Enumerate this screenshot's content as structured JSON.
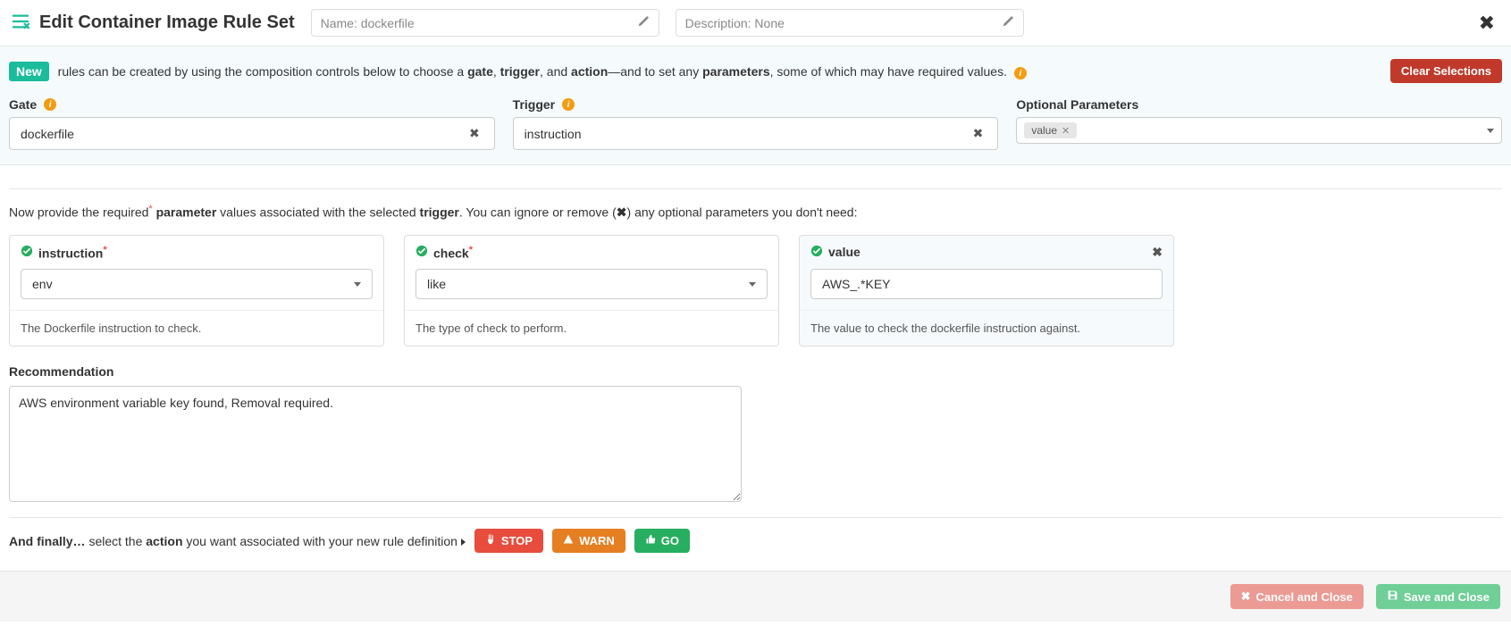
{
  "header": {
    "title": "Edit Container Image Rule Set",
    "name_label": "Name:",
    "name_value": "dockerfile",
    "desc_label": "Description:",
    "desc_value": "None"
  },
  "intro": {
    "badge": "New",
    "text_pre": " rules can be created by using the composition controls below to choose a ",
    "gate": "gate",
    "sep1": ", ",
    "trigger": "trigger",
    "sep2": ", and ",
    "action": "action",
    "mid": "—and to set any ",
    "parameters": "parameters",
    "tail": ", some of which may have required values.",
    "clear_btn": "Clear Selections"
  },
  "controls": {
    "gate_label": "Gate",
    "gate_value": "dockerfile",
    "trigger_label": "Trigger",
    "trigger_value": "instruction",
    "optparams_label": "Optional Parameters",
    "optparams_tag": "value"
  },
  "params_intro": {
    "pre": "Now provide the required",
    "mid1": " parameter",
    "mid2": " values associated with the selected ",
    "trig": "trigger",
    "mid3": ". You can ignore or remove (",
    "mid4": ") any optional parameters you don't need:"
  },
  "cards": {
    "instruction": {
      "title": "instruction",
      "value": "env",
      "desc": "The Dockerfile instruction to check."
    },
    "check": {
      "title": "check",
      "value": "like",
      "desc": "The type of check to perform."
    },
    "value": {
      "title": "value",
      "value": "AWS_.*KEY",
      "desc": "The value to check the dockerfile instruction against."
    }
  },
  "recommendation": {
    "label": "Recommendation",
    "text": "AWS environment variable key found, Removal required."
  },
  "actions": {
    "lead_bold": "And finally…",
    "lead_rest": " select the ",
    "action_word": "action",
    "lead_tail": " you want associated with your new rule definition",
    "stop": "STOP",
    "warn": "WARN",
    "go": "GO"
  },
  "footer": {
    "cancel": "Cancel and Close",
    "save": "Save and Close"
  }
}
